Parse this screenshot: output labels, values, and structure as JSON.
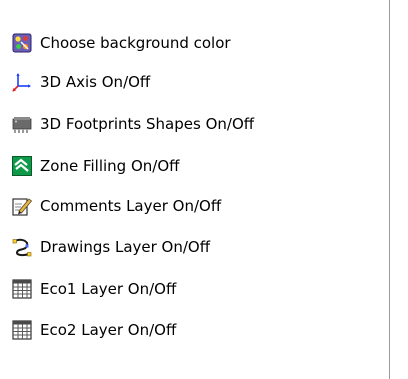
{
  "menu": {
    "items": [
      {
        "label": "Choose background color",
        "icon": "palette-icon"
      },
      {
        "label": "3D Axis On/Off",
        "icon": "axis-3d-icon"
      },
      {
        "label": "3D Footprints Shapes On/Off",
        "icon": "footprint-shapes-icon"
      },
      {
        "label": "Zone Filling On/Off",
        "icon": "zone-fill-icon"
      },
      {
        "label": "Comments Layer On/Off",
        "icon": "comments-layer-icon"
      },
      {
        "label": "Drawings Layer On/Off",
        "icon": "drawings-layer-icon"
      },
      {
        "label": "Eco1 Layer On/Off",
        "icon": "grid-layer-icon"
      },
      {
        "label": "Eco2 Layer On/Off",
        "icon": "grid-layer-icon"
      }
    ]
  },
  "colors": {
    "text": "#000000",
    "hover": "#e8eef8",
    "border": "#9a9a9a"
  }
}
